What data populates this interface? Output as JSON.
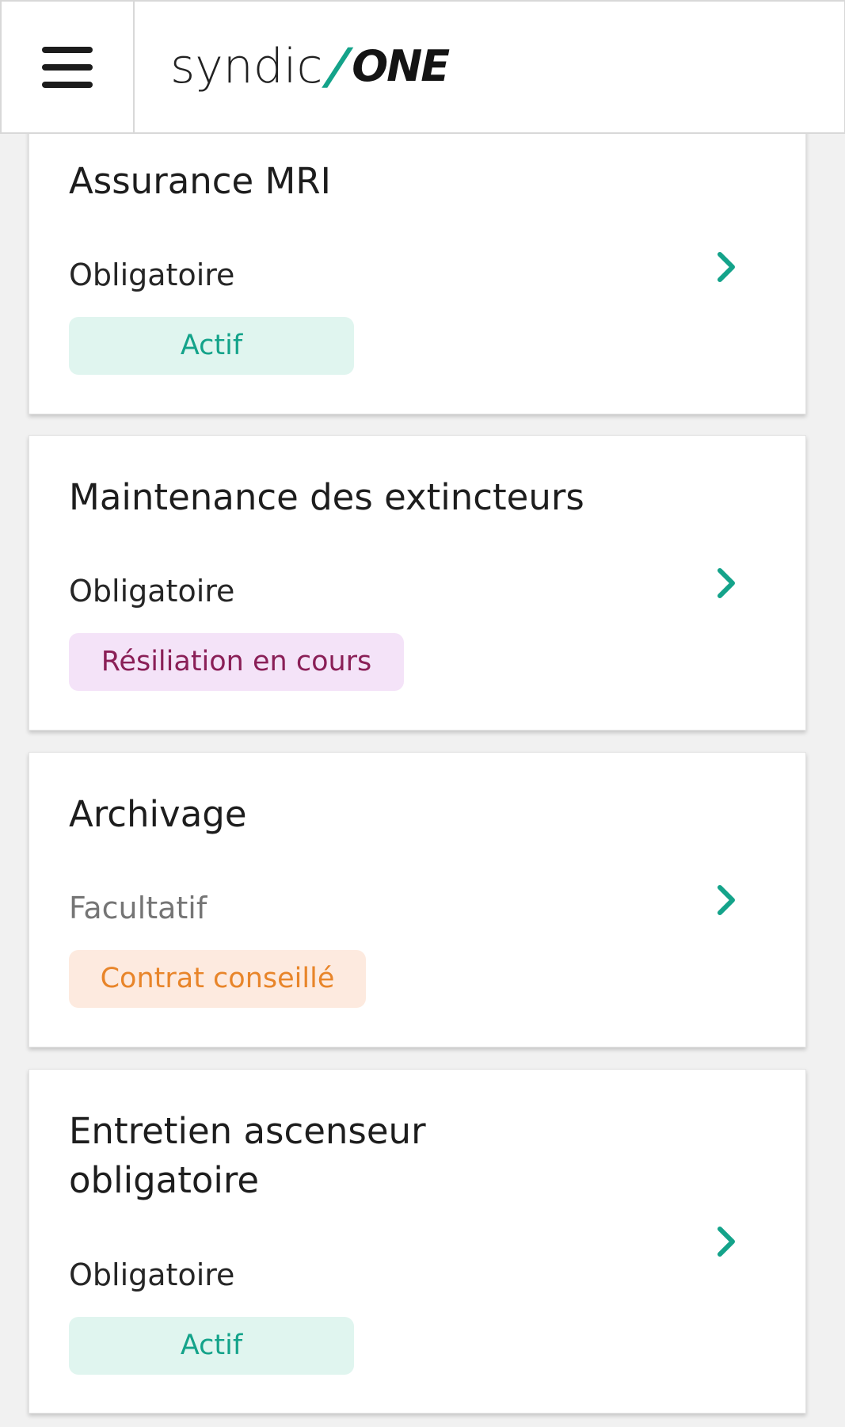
{
  "header": {
    "logo_light": "syndic",
    "logo_slash": "/",
    "logo_bold": "ONE",
    "brand_color": "#14a38a"
  },
  "cards": [
    {
      "title": "Assurance MRI",
      "subtitle": "Obligatoire",
      "badge": "Actif",
      "badge_style": "green",
      "icon": "chevron-right-icon"
    },
    {
      "title": "Maintenance des extincteurs",
      "subtitle": "Obligatoire",
      "badge": "Résiliation en cours",
      "badge_style": "purple",
      "icon": "chevron-right-icon"
    },
    {
      "title": "Archivage",
      "subtitle": "Facultatif",
      "badge": "Contrat conseillé",
      "badge_style": "orange",
      "icon": "chevron-right-icon"
    },
    {
      "title": "Entretien ascenseur obligatoire",
      "subtitle": "Obligatoire",
      "badge": "Actif",
      "badge_style": "green",
      "icon": "chevron-right-icon"
    }
  ]
}
